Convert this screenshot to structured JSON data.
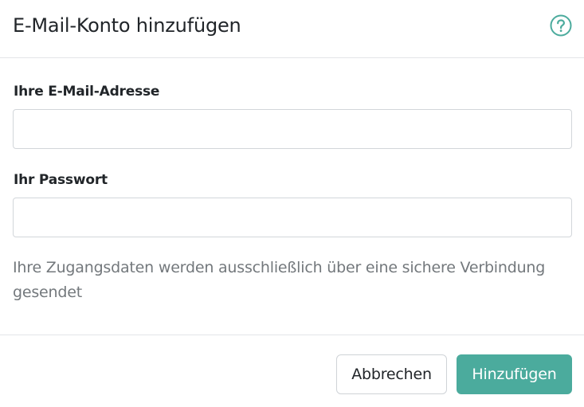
{
  "dialog": {
    "title": "E-Mail-Konto hinzufügen",
    "help_icon": "question-circle-icon",
    "accent_color": "#4bab9d"
  },
  "form": {
    "email_label": "Ihre E-Mail-Adresse",
    "email_value": "",
    "password_label": "Ihr Passwort",
    "password_value": "",
    "note": "Ihre Zugangsdaten werden ausschließlich über eine sichere Verbindung gesendet"
  },
  "footer": {
    "cancel_label": "Abbrechen",
    "add_label": "Hinzufügen"
  }
}
